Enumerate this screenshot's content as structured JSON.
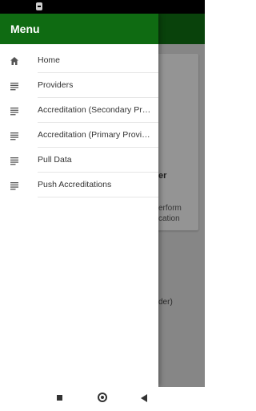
{
  "drawer": {
    "title": "Menu",
    "items": [
      {
        "label": "Home",
        "icon": "home-icon"
      },
      {
        "label": "Providers",
        "icon": "list-icon"
      },
      {
        "label": "Accreditation (Secondary Pr…",
        "icon": "list-icon"
      },
      {
        "label": "Accreditation (Primary Provi…",
        "icon": "list-icon"
      },
      {
        "label": "Pull Data",
        "icon": "list-icon"
      },
      {
        "label": "Push Accreditations",
        "icon": "list-icon"
      }
    ]
  },
  "background": {
    "fragment_1": "er",
    "fragment_2": "erform",
    "fragment_3": "cation",
    "fragment_4": "der)"
  },
  "colors": {
    "primary": "#0f6b12",
    "drawer_bg": "#ffffff",
    "text": "#333333"
  }
}
